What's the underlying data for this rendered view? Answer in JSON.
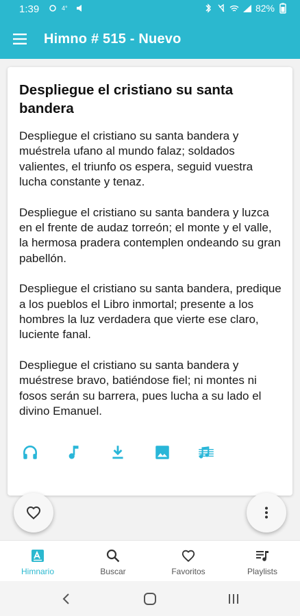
{
  "status_bar": {
    "time": "1:39",
    "battery": "82%"
  },
  "app_bar": {
    "title": "Himno # 515 - Nuevo"
  },
  "hymn": {
    "title": "Despliegue el cristiano su santa bandera",
    "verses": [
      "Despliegue el cristiano su santa bandera y muéstrela ufano al mundo falaz; soldados valientes, el triunfo os espera, seguid vuestra lucha constante y tenaz.",
      "Despliegue el cristiano su santa bandera y luzca en el frente de audaz torreón; el monte y el valle, la hermosa pradera contemplen ondeando su gran pabellón.",
      "Despliegue el cristiano su santa bandera, predique a los pueblos el Libro inmortal; presente a los hombres la luz verdadera que vierte ese claro, luciente fanal.",
      "Despliegue el cristiano su santa bandera y muéstrese bravo, batiéndose fiel; ni montes ni fosos serán su barrera, pues lucha a su lado el divino Emanuel."
    ]
  },
  "actions": [
    "headphones-icon",
    "music-note-icon",
    "download-icon",
    "image-icon",
    "sheet-music-icon"
  ],
  "bottom_nav": {
    "items": [
      {
        "label": "Himnario",
        "icon": "hymnal-icon",
        "active": true
      },
      {
        "label": "Buscar",
        "icon": "search-icon",
        "active": false
      },
      {
        "label": "Favoritos",
        "icon": "heart-icon",
        "active": false
      },
      {
        "label": "Playlists",
        "icon": "playlist-icon",
        "active": false
      }
    ]
  },
  "colors": {
    "accent": "#2bb8cf",
    "icon": "#29b6d8"
  }
}
